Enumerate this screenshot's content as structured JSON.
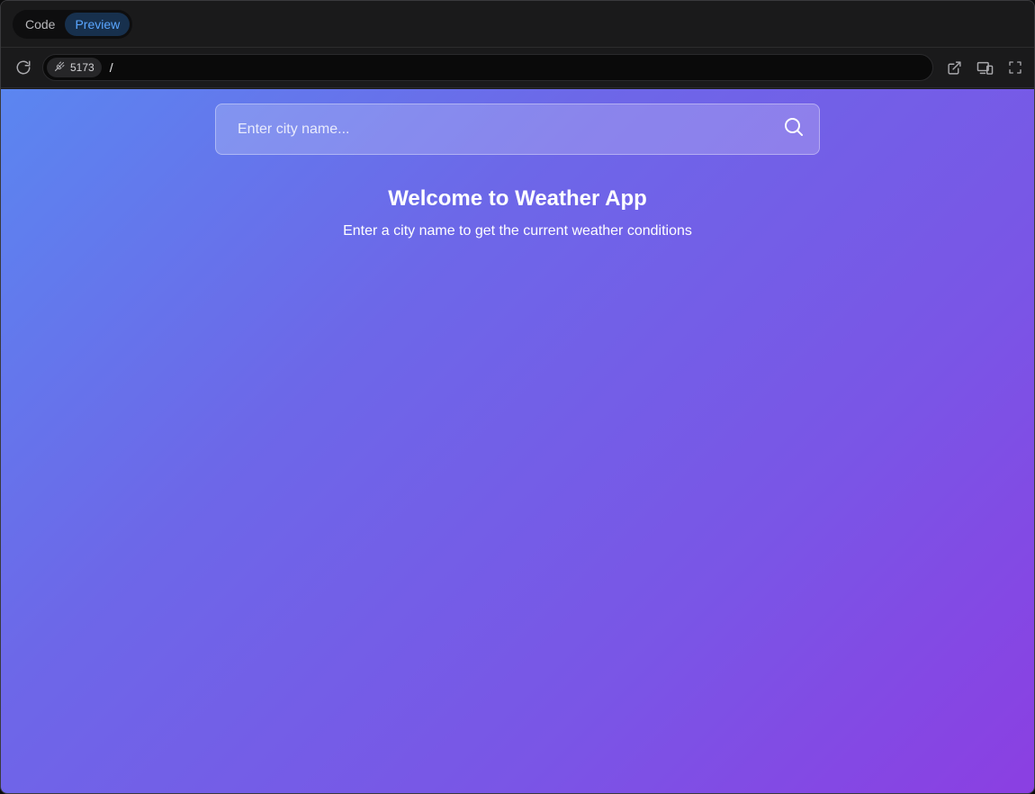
{
  "tabs": [
    {
      "label": "Code",
      "active": false
    },
    {
      "label": "Preview",
      "active": true
    }
  ],
  "address_bar": {
    "port": "5173",
    "path": "/"
  },
  "icons": {
    "reload": "reload-icon",
    "port_status": "unplugged-icon",
    "open_external": "external-link-icon",
    "responsive": "devices-icon",
    "fullscreen": "fullscreen-icon",
    "search": "search-icon"
  },
  "app": {
    "search_placeholder": "Enter city name...",
    "search_value": "",
    "welcome_title": "Welcome to Weather App",
    "welcome_subtitle": "Enter a city name to get the current weather conditions"
  },
  "colors": {
    "gradient_start": "#5b86f0",
    "gradient_end": "#8b3fe2",
    "active_tab_text": "#5aa6ff"
  }
}
